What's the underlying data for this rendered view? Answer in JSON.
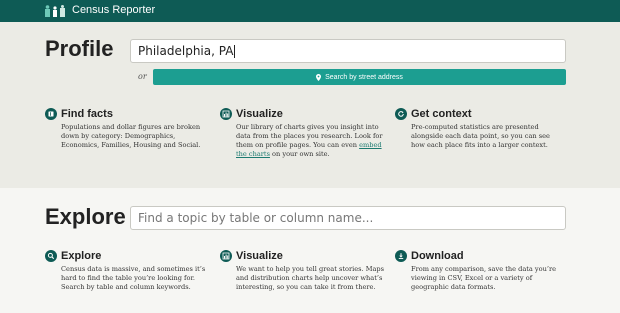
{
  "header": {
    "brand": "Census Reporter"
  },
  "profile": {
    "title": "Profile",
    "search_value": "Philadelphia, PA",
    "or_label": "or",
    "street_button_label": "Search by street address",
    "columns": [
      {
        "title": "Find facts",
        "icon": "book-icon",
        "description": "Populations and dollar figures are broken down by category: Demographics, Economics, Families, Housing and Social."
      },
      {
        "title": "Visualize",
        "icon": "chart-icon",
        "description_before": "Our library of charts gives you insight into data from the places you research. Look for them on profile pages. You can even ",
        "description_link": "embed the charts",
        "description_after": " on your own site."
      },
      {
        "title": "Get context",
        "icon": "refresh-icon",
        "description": "Pre-computed statistics are presented alongside each data point, so you can see how each place fits into a larger context."
      }
    ]
  },
  "explore": {
    "title": "Explore",
    "search_placeholder": "Find a topic by table or column name...",
    "columns": [
      {
        "title": "Explore",
        "icon": "search-icon",
        "description": "Census data is massive, and sometimes it’s hard to find the table you’re looking for. Search by table and column keywords."
      },
      {
        "title": "Visualize",
        "icon": "chart-icon",
        "description": "We want to help you tell great stories. Maps and distribution charts help uncover what’s interesting, so you can take it from there."
      },
      {
        "title": "Download",
        "icon": "download-icon",
        "description": "From any comparison, save the data you’re viewing in CSV, Excel or a variety of geographic data formats."
      }
    ]
  },
  "colors": {
    "header_bg": "#0e5b55",
    "accent": "#1c9e91"
  }
}
